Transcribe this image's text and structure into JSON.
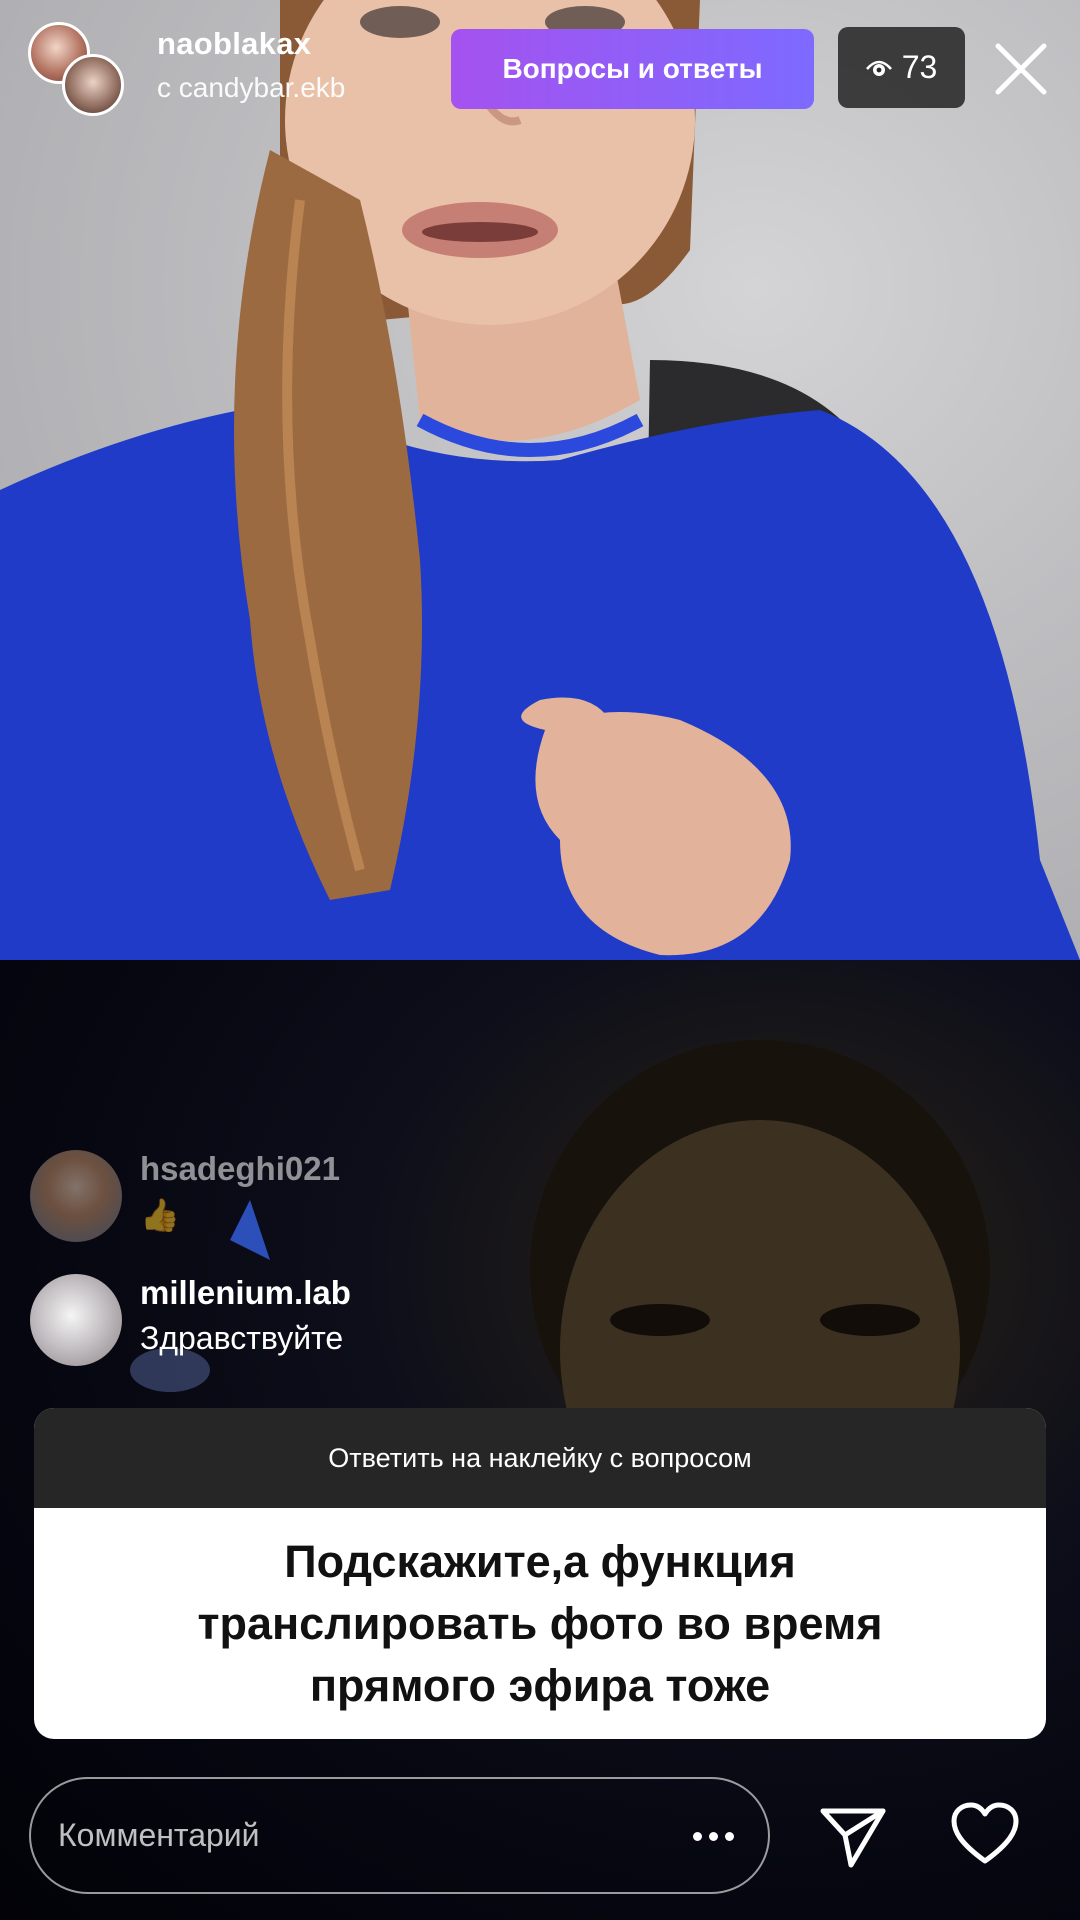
{
  "stream": {
    "host_username": "naoblakax",
    "guest_label": "с candybar.ekb",
    "qa_button_label": "Вопросы и ответы",
    "viewer_count": "73",
    "icons": {
      "viewers": "eye-icon",
      "close": "close-icon"
    }
  },
  "comments": [
    {
      "username": "hsadeghi021",
      "text": "👍"
    },
    {
      "username": "millenium.lab",
      "text": "Здравствуйте"
    }
  ],
  "question_sticker": {
    "header": "Ответить на наклейку с вопросом",
    "question": "Подскажите,а функция транслировать фото во время прямого эфира тоже"
  },
  "bottom_bar": {
    "comment_placeholder": "Комментарий",
    "icons": {
      "more": "more-dots-icon",
      "send": "send-icon",
      "like": "heart-icon"
    }
  },
  "colors": {
    "qa_gradient_start": "#a552ef",
    "qa_gradient_end": "#7d6aff",
    "shirt_blue": "#1f3bc8",
    "sticker_header": "#262626"
  }
}
